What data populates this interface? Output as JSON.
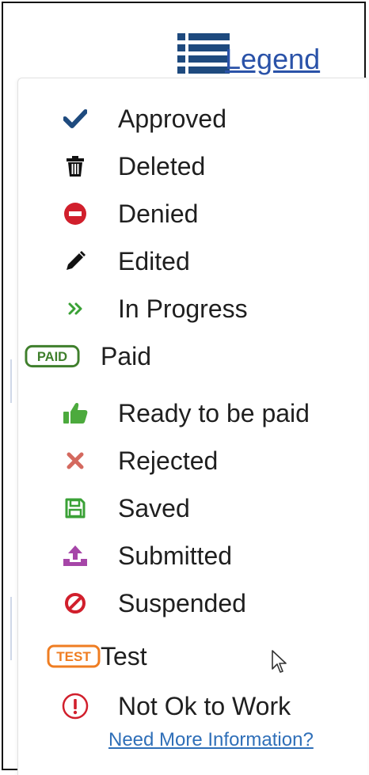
{
  "header": {
    "legend_label": "Legend",
    "icon": "list-icon"
  },
  "items": [
    {
      "label": "Approved",
      "icon": "check-icon",
      "color": "#1e4a7e"
    },
    {
      "label": "Deleted",
      "icon": "trash-icon",
      "color": "#111111"
    },
    {
      "label": "Denied",
      "icon": "minus-circle-icon",
      "color": "#d11f2c"
    },
    {
      "label": "Edited",
      "icon": "pencil-icon",
      "color": "#111111"
    },
    {
      "label": "In Progress",
      "icon": "double-chevron-icon",
      "color": "#3aa136"
    },
    {
      "label": "Paid",
      "icon": "paid-badge-icon",
      "badge": "PAID",
      "color": "#3f7f2c"
    },
    {
      "label": "Ready to be paid",
      "icon": "thumbs-up-icon",
      "color": "#4caa3d"
    },
    {
      "label": "Rejected",
      "icon": "x-icon",
      "color": "#d4695f"
    },
    {
      "label": "Saved",
      "icon": "floppy-disk-icon",
      "color": "#3aa136"
    },
    {
      "label": "Submitted",
      "icon": "upload-icon",
      "color": "#a646a8"
    },
    {
      "label": "Suspended",
      "icon": "ban-icon",
      "color": "#d11f2c"
    },
    {
      "label": "Test",
      "icon": "test-badge-icon",
      "badge": "TEST",
      "color": "#ef7d22"
    },
    {
      "label": "Not Ok to Work",
      "icon": "exclamation-circle-icon",
      "color": "#d11f2c"
    }
  ],
  "footer": {
    "more_info_link": "Need More Information?"
  }
}
